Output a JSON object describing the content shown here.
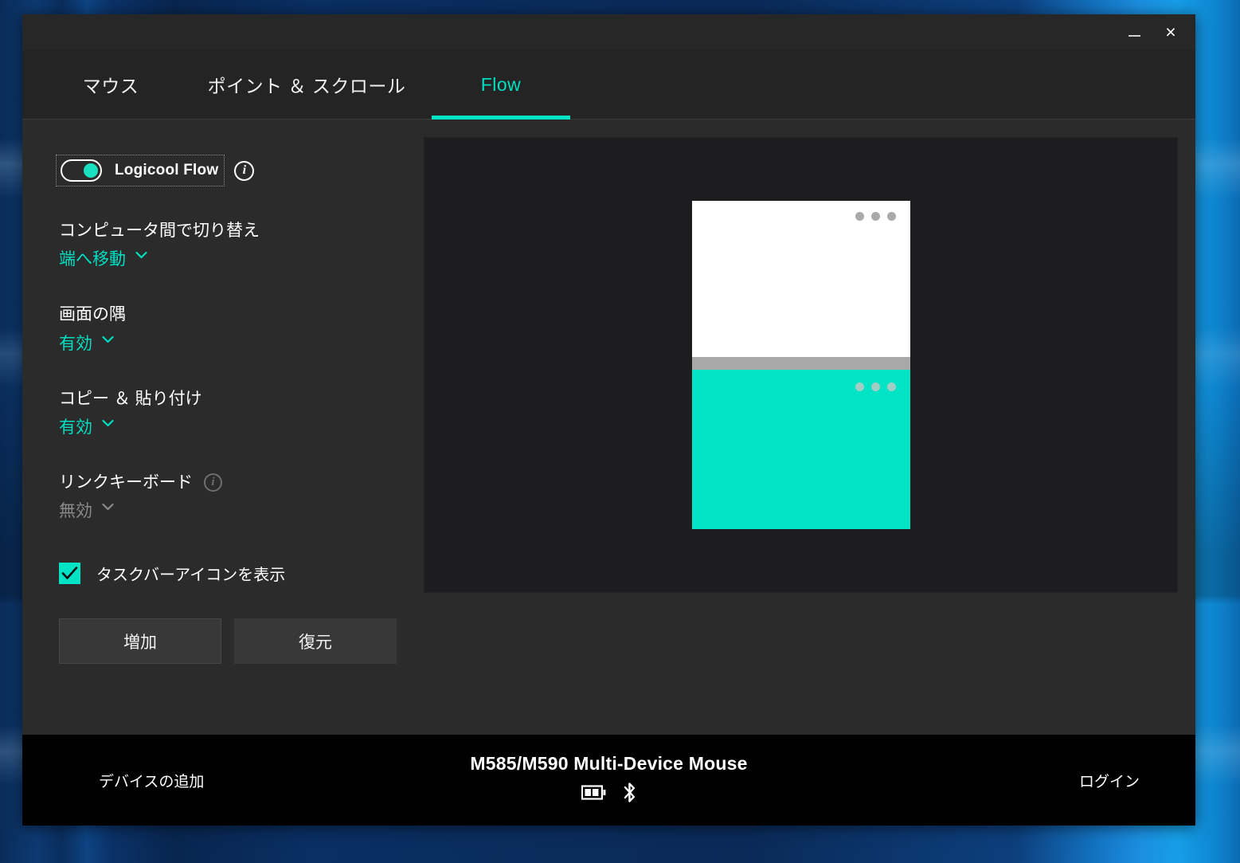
{
  "window": {
    "minimize_label": "_",
    "close_label": "×"
  },
  "tabs": [
    {
      "label": "マウス",
      "active": false
    },
    {
      "label": "ポイント ＆ スクロール",
      "active": false
    },
    {
      "label": "Flow",
      "active": true
    }
  ],
  "settings": {
    "flow_toggle": {
      "label": "Logicool Flow",
      "state": "on",
      "info_icon": "info-icon"
    },
    "items": [
      {
        "title": "コンピュータ間で切り替え",
        "value": "端へ移動",
        "disabled": false,
        "has_info": false
      },
      {
        "title": "画面の隅",
        "value": "有効",
        "disabled": false,
        "has_info": false
      },
      {
        "title": "コピー ＆ 貼り付け",
        "value": "有効",
        "disabled": false,
        "has_info": false
      },
      {
        "title": "リンクキーボード",
        "value": "無効",
        "disabled": true,
        "has_info": true
      }
    ],
    "checkbox": {
      "label": "タスクバーアイコンを表示",
      "checked": true
    },
    "buttons": {
      "add": "増加",
      "restore": "復元"
    }
  },
  "illustration": {
    "top_screen_color": "#ffffff",
    "divider_color": "#a8a8a8",
    "bottom_screen_color": "#00e3c4",
    "dot_count": 3
  },
  "footer": {
    "add_device_label": "デバイスの追加",
    "device_name": "M585/M590 Multi-Device Mouse",
    "battery_icon": "battery-icon",
    "battery_level_bars": 2,
    "bluetooth_icon": "bluetooth-icon",
    "login_label": "ログイン"
  },
  "colors": {
    "accent": "#00e3c4",
    "accent_text": "#00dfc2",
    "window_bg": "#2b2b2b",
    "panel_bg": "#1d1d1f",
    "footer_bg": "#000000"
  }
}
